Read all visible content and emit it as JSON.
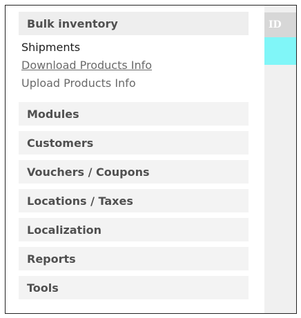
{
  "sidebar": {
    "bulk_inventory": "Bulk inventory",
    "sub_items": [
      "Shipments",
      "Download Products Info",
      "Upload Products Info"
    ],
    "items": [
      "Modules",
      "Customers",
      "Vouchers / Coupons",
      "Locations / Taxes",
      "Localization",
      "Reports",
      "Tools"
    ]
  },
  "table": {
    "id_header": "ID"
  },
  "colors": {
    "highlight": "#80f6f8",
    "header_bg": "#d7d7d7",
    "menu_bg": "#f3f3f3"
  }
}
